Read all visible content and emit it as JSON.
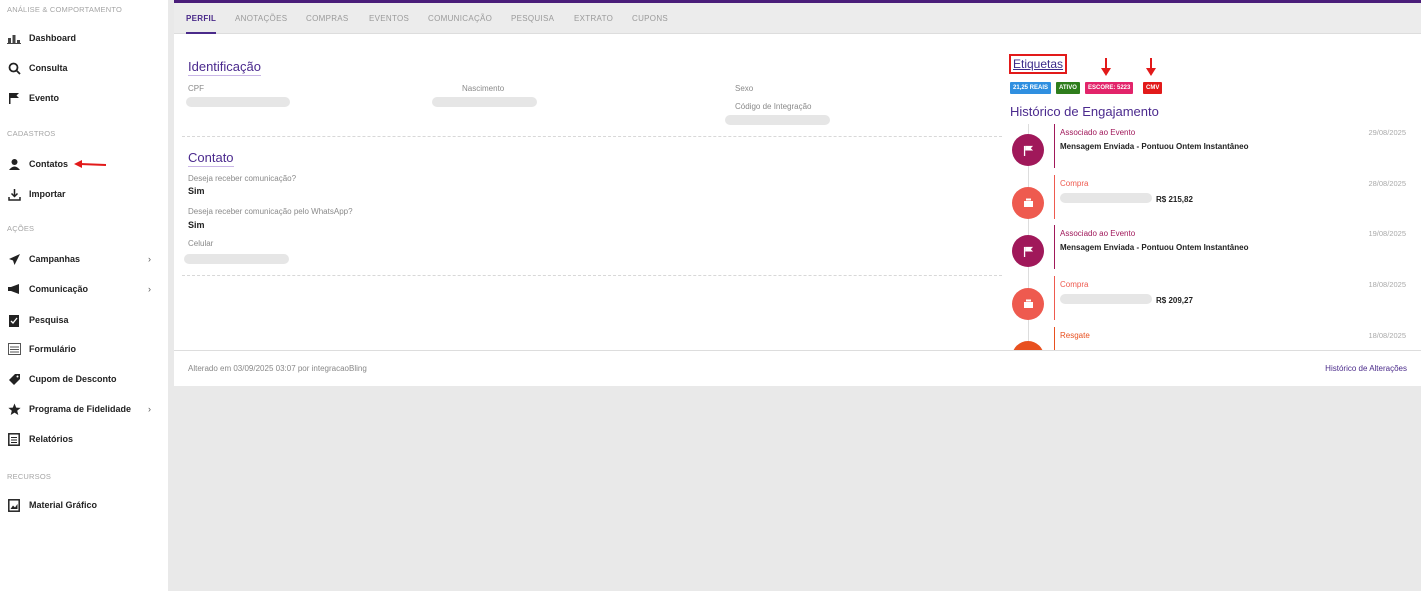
{
  "sidebar": {
    "sections": [
      {
        "title": "ANÁLISE & COMPORTAMENTO"
      },
      {
        "title": "CADASTROS"
      },
      {
        "title": "AÇÕES"
      },
      {
        "title": "RECURSOS"
      }
    ],
    "items": [
      {
        "label": "Dashboard",
        "icon": "chart-icon"
      },
      {
        "label": "Consulta",
        "icon": "search-icon"
      },
      {
        "label": "Evento",
        "icon": "flag-icon"
      },
      {
        "label": "Contatos",
        "icon": "user-icon"
      },
      {
        "label": "Importar",
        "icon": "download-icon"
      },
      {
        "label": "Campanhas",
        "icon": "paper-plane-icon"
      },
      {
        "label": "Comunicação",
        "icon": "megaphone-icon"
      },
      {
        "label": "Pesquisa",
        "icon": "clipboard-icon"
      },
      {
        "label": "Formulário",
        "icon": "form-icon"
      },
      {
        "label": "Cupom de Desconto",
        "icon": "tag-icon"
      },
      {
        "label": "Programa de Fidelidade",
        "icon": "star-icon"
      },
      {
        "label": "Relatórios",
        "icon": "report-icon"
      },
      {
        "label": "Material Gráfico",
        "icon": "image-icon"
      }
    ],
    "chevron": "›"
  },
  "tabs": [
    "PERFIL",
    "ANOTAÇÕES",
    "COMPRAS",
    "EVENTOS",
    "COMUNICAÇÃO",
    "PESQUISA",
    "EXTRATO",
    "CUPONS"
  ],
  "profile": {
    "identificacao_title": "Identificação",
    "cpf_label": "CPF",
    "nascimento_label": "Nascimento",
    "sexo_label": "Sexo",
    "codigo_label": "Código de Integração",
    "contato_title": "Contato",
    "recebe_label": "Deseja receber comunicação?",
    "recebe_value": "Sim",
    "whatsapp_label": "Deseja receber comunicação pelo WhatsApp?",
    "whatsapp_value": "Sim",
    "celular_label": "Celular"
  },
  "etiquetas": {
    "title": "Etiquetas",
    "tags": [
      {
        "label": "21,25 REAIS",
        "color": "#2f8fe0"
      },
      {
        "label": "ATIVO",
        "color": "#2e7d1c"
      },
      {
        "label": "ESCORE: 5223",
        "color": "#e2246a"
      },
      {
        "label": "CMV",
        "color": "#e21a1a"
      }
    ]
  },
  "historico": {
    "title": "Histórico de Engajamento",
    "entries": [
      {
        "type": "Associado ao Evento",
        "date": "29/08/2025",
        "desc": "Mensagem Enviada - Pontuou Ontem Instantâneo",
        "color": "#a0185a",
        "icon": "flag-icon"
      },
      {
        "type": "Compra",
        "date": "28/08/2025",
        "amount": "R$ 215,82",
        "color": "#ee5a4f",
        "icon": "cash-register-icon"
      },
      {
        "type": "Associado ao Evento",
        "date": "19/08/2025",
        "desc": "Mensagem Enviada - Pontuou Ontem Instantâneo",
        "color": "#a0185a",
        "icon": "flag-icon"
      },
      {
        "type": "Compra",
        "date": "18/08/2025",
        "amount": "R$ 209,27",
        "color": "#ee5a4f",
        "icon": "cash-register-icon"
      },
      {
        "type": "Resgate",
        "date": "18/08/2025",
        "color": "#e8501f",
        "icon": "gift-icon"
      }
    ]
  },
  "footer": {
    "altered": "Alterado em 03/09/2025 03:07 por integracaoBling",
    "history_link": "Histórico de Alterações"
  },
  "colors": {
    "accent": "#4a1d7a",
    "annotation_red": "#e21a1a"
  }
}
